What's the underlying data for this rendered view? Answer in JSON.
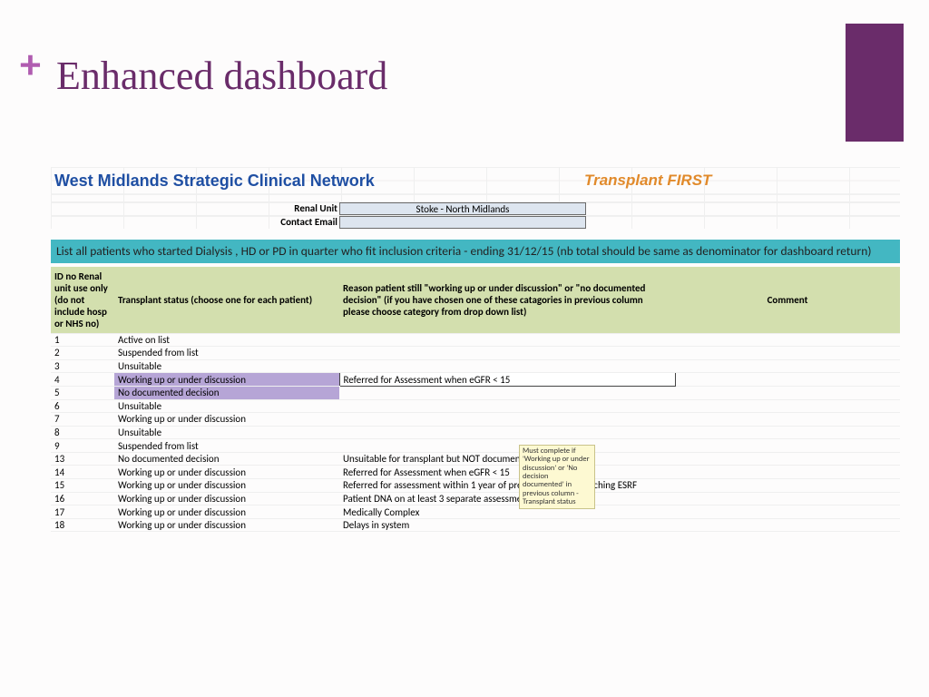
{
  "slide": {
    "plus": "+",
    "title": "Enhanced dashboard"
  },
  "header": {
    "network": "West Midlands Strategic Clinical Network",
    "program": "Transplant FIRST"
  },
  "form": {
    "renal_unit_label": "Renal Unit",
    "renal_unit_value": "Stoke - North Midlands",
    "contact_label": "Contact Email",
    "contact_value": ""
  },
  "instruction": "List all patients who started Dialysis , HD or PD in quarter who fit inclusion criteria - ending 31/12/15 (nb total should be same as denominator for dashboard return)",
  "columns": {
    "id": "ID no Renal unit use only (do not include hosp or NHS no)",
    "status": "Transplant status (choose one for each patient)",
    "reason": "Reason patient still \"working up or under discussion\" or  \"no documented decision\" (if you have chosen one of these catagories in previous column please choose category from drop down list)",
    "comment": "Comment"
  },
  "rows": [
    {
      "id": "1",
      "status": "Active on list",
      "reason": ""
    },
    {
      "id": "2",
      "status": "Suspended from list",
      "reason": ""
    },
    {
      "id": "3",
      "status": "Unsuitable",
      "reason": ""
    },
    {
      "id": "4",
      "status": "Working up or under discussion",
      "reason": "Referred for Assessment when eGFR < 15",
      "highlight": true,
      "dropdown": true
    },
    {
      "id": "5",
      "status": "No documented decision",
      "reason": "",
      "highlight": true
    },
    {
      "id": "6",
      "status": "Unsuitable",
      "reason": ""
    },
    {
      "id": "7",
      "status": "Working up or under discussion",
      "reason": ""
    },
    {
      "id": "8",
      "status": "Unsuitable",
      "reason": ""
    },
    {
      "id": "9",
      "status": "Suspended from list",
      "reason": ""
    },
    {
      "id": "13",
      "status": "No documented decision",
      "reason": "Unsuitable for transplant but NOT documented"
    },
    {
      "id": "14",
      "status": "Working up or under discussion",
      "reason": "Referred for Assessment when eGFR < 15"
    },
    {
      "id": "15",
      "status": "Working up or under discussion",
      "reason": "Referred for assessment within 1 year of predicted date of reaching ESRF"
    },
    {
      "id": "16",
      "status": "Working up or under discussion",
      "reason": "Patient DNA on at least 3 separate assessment Appointments"
    },
    {
      "id": "17",
      "status": "Working up or under discussion",
      "reason": "Medically Complex"
    },
    {
      "id": "18",
      "status": "Working up or under discussion",
      "reason": "Delays in system"
    }
  ],
  "tooltip": "Must complete if 'Working up or under discussion' or  'No decision documented' in previous column - Transplant status"
}
